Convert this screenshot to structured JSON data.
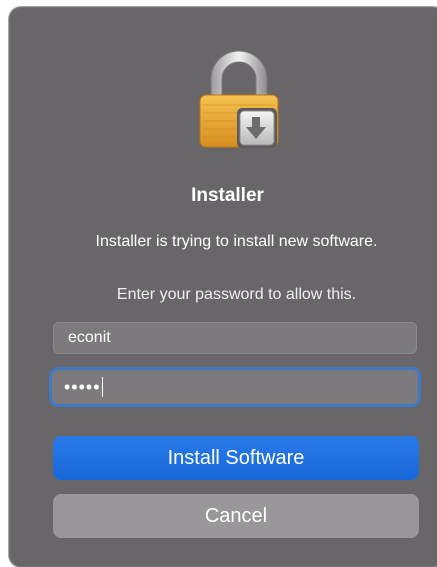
{
  "dialog": {
    "icon": "lock-installer-icon",
    "title": "Installer",
    "message": "Installer is trying to install new software.",
    "prompt": "Enter your password to allow this.",
    "username": {
      "value": "econit",
      "placeholder": ""
    },
    "password": {
      "masked_value": "•••••"
    },
    "buttons": {
      "install": "Install Software",
      "cancel": "Cancel"
    },
    "colors": {
      "dialog_bg": "#69666a",
      "accent": "#1f72e4",
      "focus_ring": "#3e79c4",
      "cancel_bg": "#9a979b",
      "lock_gold": "#e7a331"
    }
  }
}
